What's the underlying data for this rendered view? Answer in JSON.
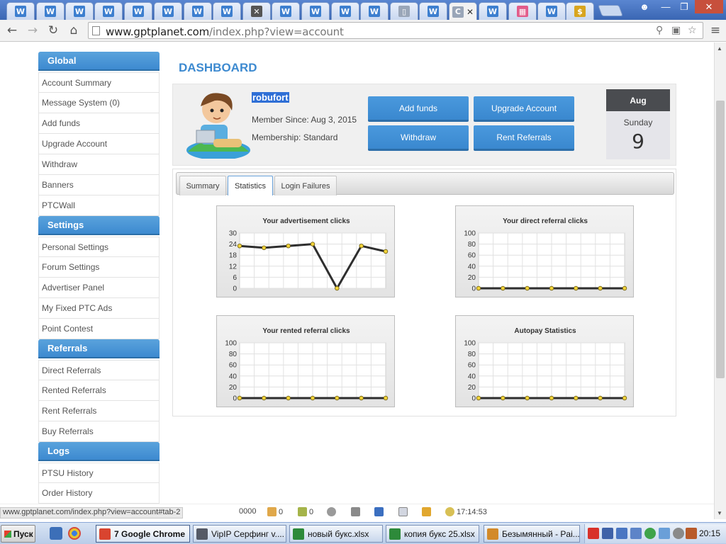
{
  "browser": {
    "tabs": [
      {
        "favicon": "W",
        "color": "#3d7fcf"
      },
      {
        "favicon": "W",
        "color": "#3d7fcf"
      },
      {
        "favicon": "W",
        "color": "#3d7fcf"
      },
      {
        "favicon": "W",
        "color": "#3d7fcf"
      },
      {
        "favicon": "W",
        "color": "#3d7fcf"
      },
      {
        "favicon": "W",
        "color": "#3d7fcf"
      },
      {
        "favicon": "W",
        "color": "#3d7fcf"
      },
      {
        "favicon": "W",
        "color": "#3d7fcf"
      },
      {
        "favicon": "✕",
        "color": "#555555"
      },
      {
        "favicon": "W",
        "color": "#3d7fcf"
      },
      {
        "favicon": "W",
        "color": "#3d7fcf"
      },
      {
        "favicon": "W",
        "color": "#3d7fcf"
      },
      {
        "favicon": "W",
        "color": "#3d7fcf"
      },
      {
        "favicon": "▯",
        "color": "#9aa6b8"
      },
      {
        "favicon": "W",
        "color": "#3d7fcf"
      },
      {
        "favicon": "C",
        "color": "#9aa6b8",
        "active": true
      },
      {
        "favicon": "W",
        "color": "#3d7fcf"
      },
      {
        "favicon": "▦",
        "color": "#e25b8a"
      },
      {
        "favicon": "W",
        "color": "#3d7fcf"
      },
      {
        "favicon": "$",
        "color": "#d8a520"
      }
    ],
    "url_host": "www.gptplanet.com",
    "url_path": "/index.php?view=account"
  },
  "sidebar": {
    "sections": [
      {
        "title": "Global",
        "items": [
          "Account Summary",
          "Message System (0)",
          "Add funds",
          "Upgrade Account",
          "Withdraw",
          "Banners",
          "PTCWall"
        ]
      },
      {
        "title": "Settings",
        "items": [
          "Personal Settings",
          "Forum Settings",
          "Advertiser Panel",
          "My Fixed PTC Ads",
          "Point Contest"
        ]
      },
      {
        "title": "Referrals",
        "items": [
          "Direct Referrals",
          "Rented Referrals",
          "Rent Referrals",
          "Buy Referrals"
        ]
      },
      {
        "title": "Logs",
        "items": [
          "PTSU History",
          "Order History"
        ]
      }
    ]
  },
  "dashboard": {
    "title": "DASHBOARD",
    "username": "robufort",
    "member_since": "Member Since: Aug 3, 2015",
    "membership": "Membership: Standard",
    "buttons": {
      "add_funds": "Add funds",
      "upgrade": "Upgrade Account",
      "withdraw": "Withdraw",
      "rent_referrals": "Rent Referrals"
    },
    "date": {
      "month": "Aug",
      "weekday": "Sunday",
      "day": "9"
    },
    "tabs": [
      "Summary",
      "Statistics",
      "Login Failures"
    ],
    "active_tab": "Statistics"
  },
  "chart_data": [
    {
      "type": "line",
      "title": "Your advertisement clicks",
      "ylim": [
        0,
        30
      ],
      "yticks": [
        0,
        6,
        12,
        18,
        24,
        30
      ],
      "values": [
        23,
        22,
        23,
        24,
        0,
        23,
        20
      ]
    },
    {
      "type": "line",
      "title": "Your direct referral clicks",
      "ylim": [
        0,
        100
      ],
      "yticks": [
        0,
        20,
        40,
        60,
        80,
        100
      ],
      "values": [
        0,
        0,
        0,
        0,
        0,
        0,
        0
      ]
    },
    {
      "type": "line",
      "title": "Your rented referral clicks",
      "ylim": [
        0,
        100
      ],
      "yticks": [
        0,
        20,
        40,
        60,
        80,
        100
      ],
      "values": [
        0,
        0,
        0,
        0,
        0,
        0,
        0
      ]
    },
    {
      "type": "line",
      "title": "Autopay Statistics",
      "ylim": [
        0,
        100
      ],
      "yticks": [
        0,
        20,
        40,
        60,
        80,
        100
      ],
      "values": [
        0,
        0,
        0,
        0,
        0,
        0,
        0
      ]
    }
  ],
  "statusbar": {
    "hover_url": "www.gptplanet.com/index.php?view=account#tab-2",
    "balance_fragment": "0000",
    "count1": "0",
    "count2": "0",
    "time": "17:14:53"
  },
  "taskbar": {
    "start": "Пуск",
    "tasks": [
      {
        "label": "7 Google Chrome",
        "icon_color": "#d9442f",
        "active": true
      },
      {
        "label": "VipIP Серфинг  v....",
        "icon_color": "#555a66"
      },
      {
        "label": "новый букс.xlsx",
        "icon_color": "#2d8a3a"
      },
      {
        "label": "копия букс 25.xlsx",
        "icon_color": "#2d8a3a"
      },
      {
        "label": "Безымянный - Pai...",
        "icon_color": "#d28a2a"
      }
    ],
    "clock": "20:15"
  }
}
